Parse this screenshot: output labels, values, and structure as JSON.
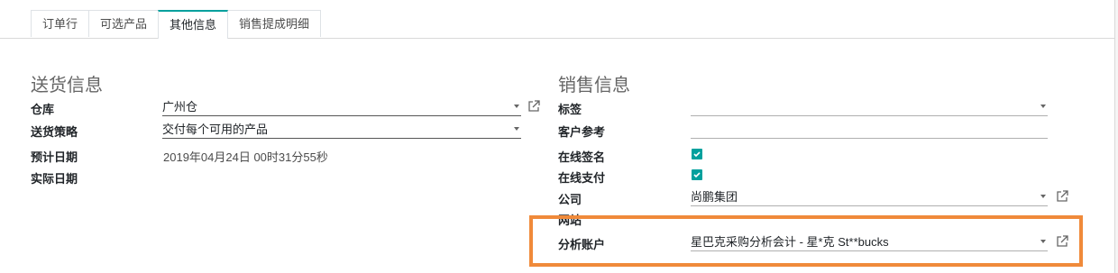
{
  "tabs": [
    {
      "label": "订单行"
    },
    {
      "label": "可选产品"
    },
    {
      "label": "其他信息"
    },
    {
      "label": "销售提成明细"
    }
  ],
  "delivery": {
    "title": "送货信息",
    "warehouse_label": "仓库",
    "warehouse_value": "广州仓",
    "policy_label": "送货策略",
    "policy_value": "交付每个可用的产品",
    "expected_label": "预计日期",
    "expected_value": "2019年04月24日 00时31分55秒",
    "effective_label": "实际日期"
  },
  "sales": {
    "title": "销售信息",
    "tags_label": "标签",
    "customer_ref_label": "客户参考",
    "online_sign_label": "在线签名",
    "online_pay_label": "在线支付",
    "company_label": "公司",
    "company_value": "尚鹏集团",
    "website_label": "网站",
    "analytic_label": "分析账户",
    "analytic_value": "星巴克采购分析会计 - 星*克  St**bucks"
  },
  "colors": {
    "accent": "#00a09d",
    "highlight": "#f08a3a"
  }
}
